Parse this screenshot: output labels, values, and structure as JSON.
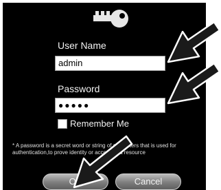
{
  "dialog": {
    "icon": "key-icon",
    "username": {
      "label": "User Name",
      "value": "admin"
    },
    "password": {
      "label": "Password",
      "value": "●●●●●"
    },
    "remember": {
      "label": "Remember Me",
      "checked": false
    },
    "hint": "* A password is a secret word or string of characters that is used for authentication,to prove identity or access to a resource",
    "buttons": {
      "ok": "OK",
      "cancel": "Cancel"
    }
  },
  "colors": {
    "dialog_background": "#000000",
    "text": "#f2f2f2",
    "button": "#8a8a8a",
    "annotation_arrow": "#1a1a1a"
  },
  "annotations": {
    "arrow_icon": "pointer-arrow-icon",
    "count": 3
  }
}
